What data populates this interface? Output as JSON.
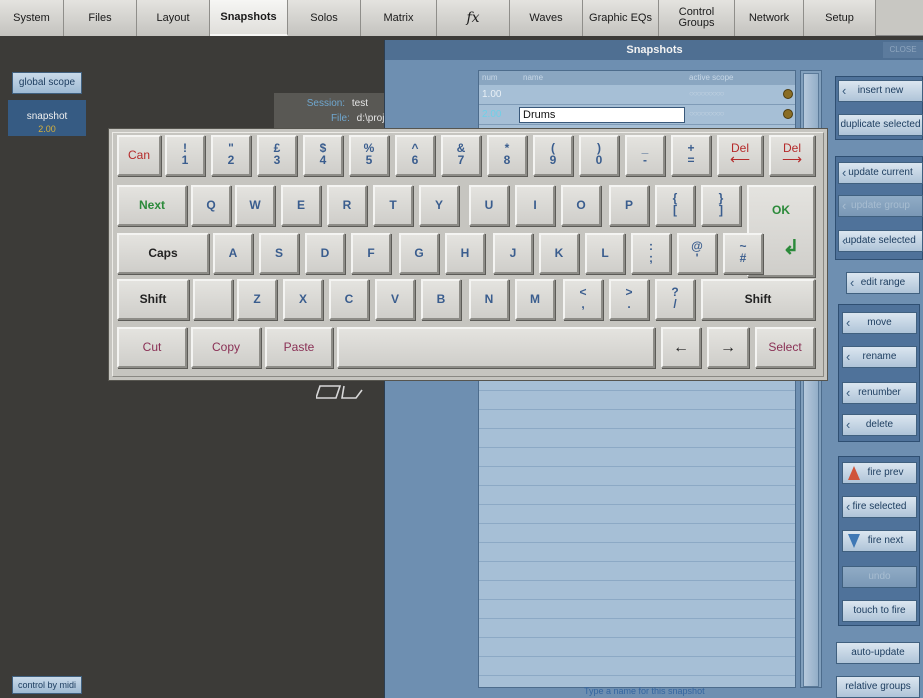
{
  "nav": {
    "tabs": [
      {
        "label": "System"
      },
      {
        "label": "Files"
      },
      {
        "label": "Layout"
      },
      {
        "label": "Snapshots"
      },
      {
        "label": "Solos"
      },
      {
        "label": "Matrix"
      },
      {
        "label": "fx"
      },
      {
        "label": "Waves"
      },
      {
        "label": "Graphic EQs"
      },
      {
        "label": "Control\nGroups"
      },
      {
        "label": "Network"
      },
      {
        "label": "Setup"
      }
    ],
    "active": "Snapshots"
  },
  "session": {
    "session_label": "Session:",
    "session_value": "test",
    "file_label": "File:",
    "file_value": "d:\\proje"
  },
  "snapshots": {
    "title": "Snapshots",
    "close_label": "CLOSE",
    "global_scope": "global scope",
    "snapshot_tab": "snapshot",
    "snapshot_tab_sub": "2.00",
    "control_by_midi": "control by midi",
    "columns": {
      "num": "num",
      "name": "name",
      "active_scope": "active scope"
    },
    "rows": [
      {
        "num": "1.00",
        "name": "",
        "scope": "○○○○○○○○○"
      },
      {
        "num": "2.00",
        "name": "Drums",
        "scope": "○○○○○○○○○"
      }
    ],
    "hint": "Type a name for this snapshot"
  },
  "actions": {
    "insert_new": "insert new",
    "duplicate_selected": "duplicate selected",
    "update_current": "update current",
    "update_group": "update group",
    "update_selected": "update selected",
    "edit_range": "edit range",
    "move": "move",
    "rename": "rename",
    "renumber": "renumber",
    "delete": "delete",
    "fire_prev": "fire prev",
    "fire_selected": "fire selected",
    "fire_next": "fire next",
    "undo": "undo",
    "touch_to_fire": "touch to fire",
    "auto_update": "auto-update",
    "relative_groups": "relative groups"
  },
  "keyboard": {
    "can": "Can",
    "num": [
      {
        "top": "!",
        "bot": "1"
      },
      {
        "top": "\"",
        "bot": "2"
      },
      {
        "top": "£",
        "bot": "3"
      },
      {
        "top": "$",
        "bot": "4"
      },
      {
        "top": "%",
        "bot": "5"
      },
      {
        "top": "^",
        "bot": "6"
      },
      {
        "top": "&",
        "bot": "7"
      },
      {
        "top": "*",
        "bot": "8"
      },
      {
        "top": "(",
        "bot": "9"
      },
      {
        "top": ")",
        "bot": "0"
      },
      {
        "top": "_",
        "bot": "-"
      },
      {
        "top": "+",
        "bot": "="
      }
    ],
    "del_left": "Del",
    "del_right": "Del",
    "arrow_left": "⟵",
    "arrow_right": "⟶",
    "next": "Next",
    "row_q": [
      "Q",
      "W",
      "E",
      "R",
      "T",
      "Y",
      "U",
      "I",
      "O",
      "P"
    ],
    "brace_open": {
      "top": "{",
      "bot": "["
    },
    "brace_close": {
      "top": "}",
      "bot": "]"
    },
    "ok": "OK",
    "caps": "Caps",
    "row_a": [
      "A",
      "S",
      "D",
      "F",
      "G",
      "H",
      "J",
      "K",
      "L"
    ],
    "colon": {
      "top": ":",
      "bot": ";"
    },
    "at": {
      "top": "@",
      "bot": "'"
    },
    "tilde": {
      "top": "~",
      "bot": "#"
    },
    "enter_icon": "↲",
    "shift": "Shift",
    "row_z": [
      "Z",
      "X",
      "C",
      "V",
      "B",
      "N",
      "M"
    ],
    "lt": {
      "top": "<",
      "bot": ","
    },
    "gt": {
      "top": ">",
      "bot": "."
    },
    "q": {
      "top": "?",
      "bot": "/"
    },
    "cut": "Cut",
    "copy": "Copy",
    "paste": "Paste",
    "left_arrow": "←",
    "right_arrow": "→",
    "select": "Select"
  }
}
